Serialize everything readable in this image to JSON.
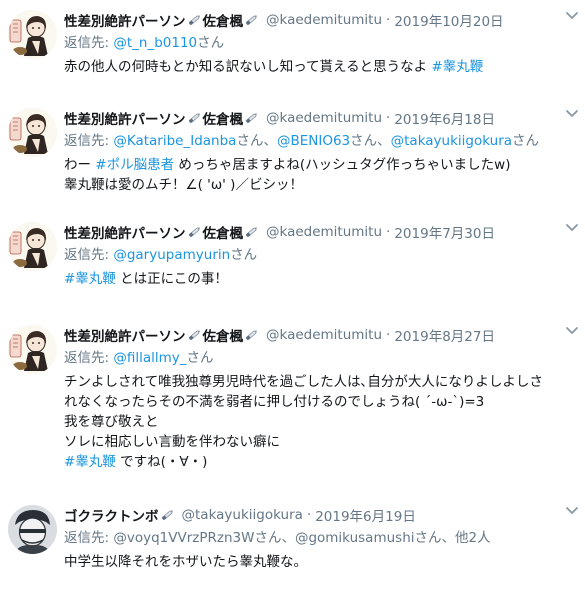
{
  "tweets": [
    {
      "name": "性差別絶許パーソン",
      "name_suffix": "佐倉楓",
      "handle": "@kaedemitumitu",
      "dot": "·",
      "time": "2019年10月20日",
      "reply_prefix": "返信先: ",
      "reply_users": [
        "@t_n_b0110"
      ],
      "reply_sep": [
        "さん"
      ],
      "lines": [
        [
          {
            "t": "赤の他人の何時もとか知る訳ないし知って貰えると思うなよ "
          },
          {
            "t": "#睾丸鞭",
            "tag": true
          }
        ]
      ]
    },
    {
      "name": "性差別絶許パーソン",
      "name_suffix": "佐倉楓",
      "handle": "@kaedemitumitu",
      "dot": "·",
      "time": "2019年6月18日",
      "reply_prefix": "返信先: ",
      "reply_users": [
        "@Kataribe_Idanba",
        "@BENIO63",
        "@takayukiigokura"
      ],
      "reply_sep": [
        "さん、",
        "さん、",
        "さん"
      ],
      "lines": [
        [
          {
            "t": "わー "
          },
          {
            "t": "#ポル脳患者",
            "tag": true
          },
          {
            "t": " めっちゃ居ますよね(ハッシュタグ作っちゃいましたw)"
          }
        ],
        [
          {
            "t": "睾丸鞭は愛のムチ！∠( 'ω' )／ビシッ！"
          }
        ]
      ]
    },
    {
      "name": "性差別絶許パーソン",
      "name_suffix": "佐倉楓",
      "handle": "@kaedemitumitu",
      "dot": "·",
      "time": "2019年7月30日",
      "reply_prefix": "返信先: ",
      "reply_users": [
        "@garyupamyurin"
      ],
      "reply_sep": [
        "さん"
      ],
      "lines": [
        [
          {
            "t": "#睾丸鞭",
            "tag": true
          },
          {
            "t": " とは正にこの事！"
          }
        ]
      ]
    },
    {
      "name": "性差別絶許パーソン",
      "name_suffix": "佐倉楓",
      "handle": "@kaedemitumitu",
      "dot": "·",
      "time": "2019年8月27日",
      "reply_prefix": "返信先: ",
      "reply_users": [
        "@fillallmy_"
      ],
      "reply_sep": [
        "さん"
      ],
      "lines": [
        [
          {
            "t": "チンよしされて唯我独尊男児時代を過ごした人は､自分が大人になりよしよしさ"
          }
        ],
        [
          {
            "t": "れなくなったらその不満を弱者に押し付けるのでしょうね( ´-ω-`)=3"
          }
        ],
        [
          {
            "t": "我を尊び敬えと"
          }
        ],
        [
          {
            "t": "ソレに相応しい言動を伴わない癖に"
          }
        ],
        [
          {
            "t": "#睾丸鞭",
            "tag": true
          },
          {
            "t": " ですね(・∀・)"
          }
        ]
      ]
    },
    {
      "name": "ゴクラクトンボ",
      "name_suffix": "",
      "handle": "@takayukiigokura",
      "dot": "·",
      "time": "2019年6月19日",
      "reply_prefix": "返信先: ",
      "reply_users": [
        "@voyq1VVrzPRzn3W",
        "@gomikusamushi"
      ],
      "reply_sep": [
        "さん、",
        "さん、他2人"
      ],
      "reply_plain": true,
      "lines": [
        [
          {
            "t": "中学生以降それをホザいたら睾丸鞭な。"
          }
        ]
      ]
    }
  ]
}
